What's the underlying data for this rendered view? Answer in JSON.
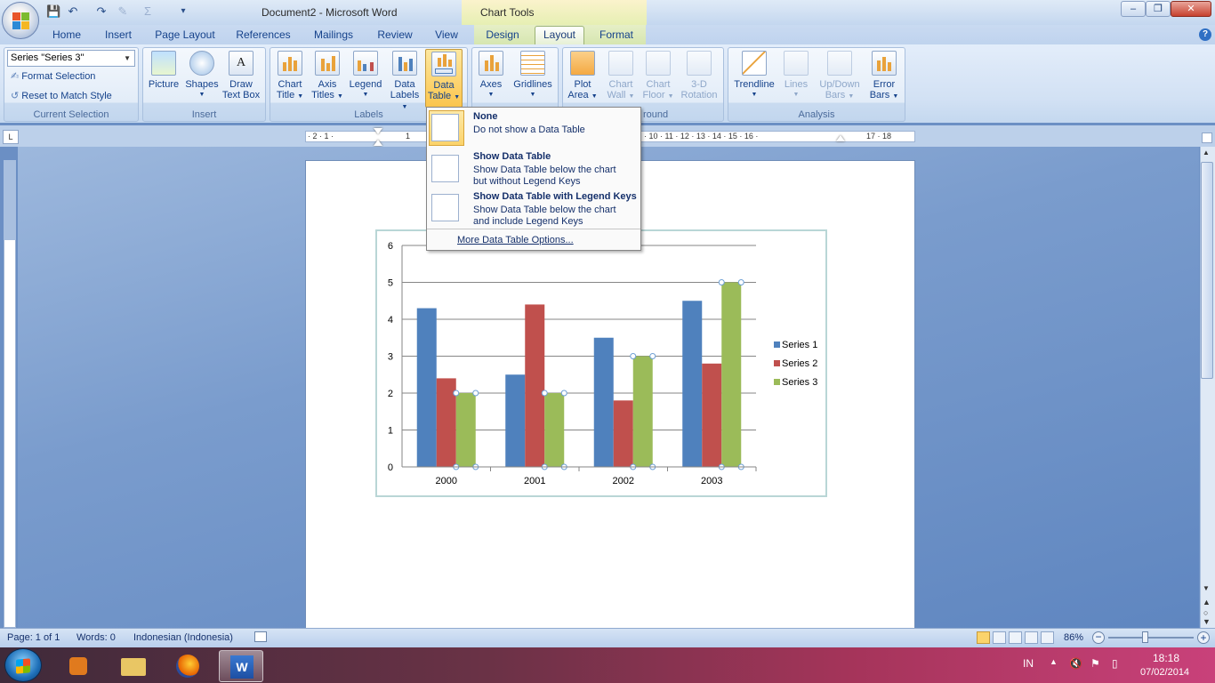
{
  "window": {
    "title": "Document2 - Microsoft Word",
    "context_title": "Chart Tools",
    "controls": [
      "–",
      "❐",
      "✕"
    ]
  },
  "tabs": [
    "Home",
    "Insert",
    "Page Layout",
    "References",
    "Mailings",
    "Review",
    "View",
    "Design",
    "Layout",
    "Format"
  ],
  "ribbon": {
    "current_selection": {
      "selected": "Series \"Series 3\"",
      "format_selection": "Format Selection",
      "reset": "Reset to Match Style",
      "label": "Current Selection"
    },
    "insert": {
      "label": "Insert",
      "picture": "Picture",
      "shapes": "Shapes",
      "draw_text_box_1": "Draw",
      "draw_text_box_2": "Text Box"
    },
    "labels": {
      "label": "Labels",
      "chart_title_1": "Chart",
      "chart_title_2": "Title",
      "axis_titles_1": "Axis",
      "axis_titles_2": "Titles",
      "legend": "Legend",
      "data_labels_1": "Data",
      "data_labels_2": "Labels",
      "data_table_1": "Data",
      "data_table_2": "Table"
    },
    "axes": {
      "axes": "Axes",
      "gridlines": "Gridlines"
    },
    "background": {
      "label_partial": "round",
      "plot_area_1": "Plot",
      "plot_area_2": "Area",
      "chart_wall_1": "Chart",
      "chart_wall_2": "Wall",
      "chart_floor_1": "Chart",
      "chart_floor_2": "Floor",
      "rotation_1": "3-D",
      "rotation_2": "Rotation"
    },
    "analysis": {
      "label": "Analysis",
      "trendline": "Trendline",
      "lines": "Lines",
      "updown_1": "Up/Down",
      "updown_2": "Bars",
      "error_1": "Error",
      "error_2": "Bars"
    }
  },
  "dropdown": {
    "none_title": "None",
    "none_desc": "Do not show a Data Table",
    "show_title": "Show Data Table",
    "show_desc_1": "Show Data Table below the chart",
    "show_desc_2": "but without Legend Keys",
    "keys_title": "Show Data Table with Legend Keys",
    "keys_desc_1": "Show Data Table below the chart",
    "keys_desc_2": "and include Legend Keys",
    "more": "More Data Table Options..."
  },
  "ruler": {
    "left_marks": "· 2 · 1 ·",
    "right_marks": "· 10 · 11 · 12 · 13 · 14 · 15 · 16 ·",
    "far_marks": "17 · 18",
    "mid_mark": "1"
  },
  "chart_data": {
    "type": "bar",
    "categories": [
      "2000",
      "2001",
      "2002",
      "2003"
    ],
    "series": [
      {
        "name": "Series 1",
        "color": "#4f81bd",
        "values": [
          4.3,
          2.5,
          3.5,
          4.5
        ]
      },
      {
        "name": "Series 2",
        "color": "#c0504d",
        "values": [
          2.4,
          4.4,
          1.8,
          2.8
        ]
      },
      {
        "name": "Series 3",
        "color": "#9bbb59",
        "values": [
          2,
          2,
          3,
          5
        ]
      }
    ],
    "ylim": [
      0,
      6
    ],
    "yticks": [
      "0",
      "1",
      "2",
      "3",
      "4",
      "5",
      "6"
    ],
    "grid": true,
    "legend": "right",
    "selected_series": "Series 3"
  },
  "status": {
    "page": "Page: 1 of 1",
    "words": "Words: 0",
    "language": "Indonesian (Indonesia)",
    "zoom": "86%",
    "zoom_value": 86
  },
  "tray": {
    "lang": "IN",
    "time": "18:18",
    "date": "07/02/2014"
  }
}
